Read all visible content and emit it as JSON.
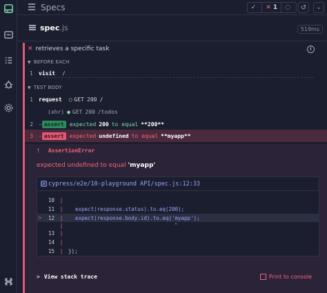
{
  "topbar": {
    "title": "Specs",
    "stats": {
      "passed": "",
      "failed": "1",
      "pending": ""
    }
  },
  "spec": {
    "name": "spec",
    "ext": ".js",
    "duration": "519ms"
  },
  "test": {
    "title": "retrieves a specific task",
    "sections": {
      "before_each": "BEFORE EACH",
      "test_body": "TEST BODY"
    },
    "before_each": [
      {
        "num": "1",
        "name": "visit",
        "arg": "/"
      }
    ],
    "commands": [
      {
        "num": "1",
        "name": "request",
        "method": "GET",
        "status": "200",
        "path": "/"
      },
      {
        "num": "",
        "name": "(xhr)",
        "method": "GET",
        "status": "200",
        "path": "/todos"
      },
      {
        "num": "2",
        "badge": "assert",
        "text_a": "expected",
        "val_a": "200",
        "text_b": "to equal",
        "val_b": "**200**"
      },
      {
        "num": "3",
        "badge": "assert",
        "text_a": "expected",
        "val_a": "undefined",
        "text_b": "to equal",
        "val_b": "**myapp**"
      }
    ]
  },
  "error": {
    "type": "AssertionError",
    "message_prefix": "expected undefined to equal ",
    "message_value": "'myapp'",
    "file": "cypress/e2e/10-playground API/spec.js:12:33",
    "code_lines": [
      {
        "ln": "10",
        "code": ""
      },
      {
        "ln": "11",
        "code": "expect(response.status).to.eq(200);"
      },
      {
        "ln": "12",
        "code": "expect(response.body.id).to.eq('myapp');"
      },
      {
        "ln": "13",
        "code": ""
      },
      {
        "ln": "14",
        "code": ""
      },
      {
        "ln": "15",
        "code": "});"
      }
    ],
    "caret": "^",
    "stack_trace_label": "View stack trace",
    "print_label": "Print to console"
  },
  "colors": {
    "pass": "#7fd8a8",
    "fail": "#f2677d",
    "link": "#9aa6ff",
    "bg": "#1b1e2e"
  }
}
